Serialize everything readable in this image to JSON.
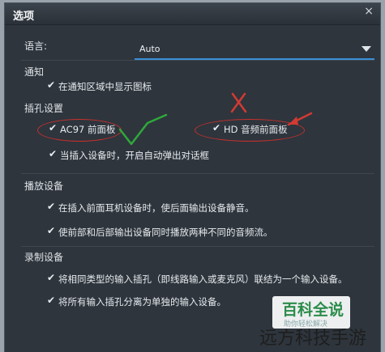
{
  "dialog": {
    "title": "选项",
    "close": "×"
  },
  "language": {
    "label": "语言:",
    "value": "Auto"
  },
  "notify": {
    "heading": "通知",
    "show_icon": {
      "label": "在通知区域中显示图标",
      "checked": true
    }
  },
  "jack": {
    "heading": "插孔设置",
    "ac97": {
      "label": "AC97 前面板",
      "checked": true
    },
    "hd": {
      "label": "HD 音频前面板",
      "checked": true
    },
    "auto_popup": {
      "label": "当插入设备时，开启自动弹出对话框",
      "checked": true
    }
  },
  "playback": {
    "heading": "播放设备",
    "mute_rear": {
      "label": "在插入前面耳机设备时，使后面输出设备静音。",
      "checked": true
    },
    "two_streams": {
      "label": "使前部和后部输出设备同时播放两种不同的音频流。",
      "checked": true
    }
  },
  "record": {
    "heading": "录制设备",
    "same_type": {
      "label": "将相同类型的输入插孔（即线路输入或麦克风）联结为一个输入设备。",
      "checked": true
    },
    "separate": {
      "label": "将所有输入插孔分离为单独的输入设备。",
      "checked": true
    }
  },
  "annotations": {
    "accent_red": "#c9302c",
    "accent_green": "#2fa83a"
  },
  "watermark": {
    "logo": "百科全说",
    "logo_sub": "助你轻松解决",
    "site": "远方科技手游"
  }
}
